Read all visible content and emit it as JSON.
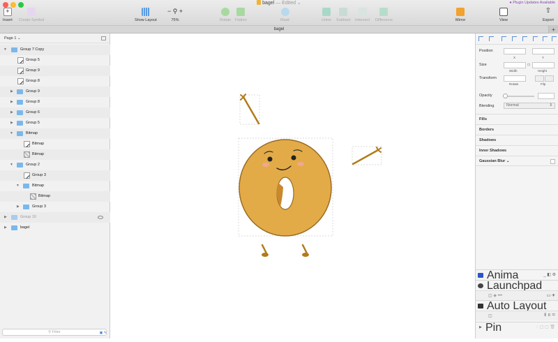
{
  "window": {
    "title": "bagel",
    "edited": "— Edited ⌄",
    "plugin_notice": "Plugin Updates Available"
  },
  "toolbar": {
    "insert": "Insert",
    "create_symbol": "Create Symbol",
    "show_layout": "Show Layout",
    "zoom": "75%",
    "rotate": "Rotate",
    "flatten": "Flatten",
    "mask": "Mask",
    "union": "Union",
    "subtract": "Subtract",
    "intersect": "Intersect",
    "difference": "Difference",
    "mirror": "Mirror",
    "view": "View",
    "export": "Export"
  },
  "tab": {
    "label": "bagel"
  },
  "layers": {
    "page": "Page 1 ⌄",
    "items": [
      {
        "label": "Group 7 Copy"
      },
      {
        "label": "Group 5"
      },
      {
        "label": "Group 9"
      },
      {
        "label": "Group 8"
      },
      {
        "label": "Group 9"
      },
      {
        "label": "Group 8"
      },
      {
        "label": "Group 6"
      },
      {
        "label": "Group 5"
      },
      {
        "label": "Bitmap"
      },
      {
        "label": "Bitmap"
      },
      {
        "label": "Bitmap"
      },
      {
        "label": "Group 2"
      },
      {
        "label": "Group 3"
      },
      {
        "label": "Bitmap"
      },
      {
        "label": "Bitmap"
      },
      {
        "label": "Group 3"
      },
      {
        "label": "Group 10"
      },
      {
        "label": "bagel"
      }
    ],
    "filter_placeholder": "Filter"
  },
  "inspector": {
    "position": "Position",
    "x": "X",
    "y": "Y",
    "size": "Size",
    "width": "Width",
    "height": "Height",
    "transform": "Transform",
    "rotate": "Rotate",
    "flip": "Flip",
    "opacity": "Opacity",
    "blending": "Blending",
    "blending_value": "Normal",
    "fills": "Fills",
    "borders": "Borders",
    "shadows": "Shadows",
    "inner_shadows": "Inner Shadows",
    "gaussian_blur": "Gaussian Blur ⌄"
  },
  "plugins": {
    "anima": "Anima",
    "launchpad": "Launchpad",
    "auto_layout": "Auto Layout",
    "pin": "Pin"
  },
  "colors": {
    "bagel_fill": "#e3ab48",
    "bagel_stroke": "#9a6a22",
    "arm": "#b07c1b",
    "folder": "#7ab8ec"
  }
}
